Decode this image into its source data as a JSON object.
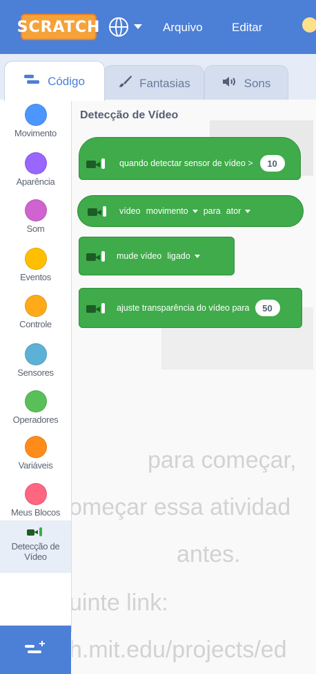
{
  "menubar": {
    "logo": "SCRATCH",
    "file_label": "Arquivo",
    "edit_label": "Editar",
    "icons": [
      "globe-icon",
      "chevron-down-icon",
      "lightbulb-icon"
    ]
  },
  "tabs": [
    {
      "label": "Código",
      "icon": "code-icon",
      "active": true
    },
    {
      "label": "Fantasias",
      "icon": "brush-icon",
      "active": false
    },
    {
      "label": "Sons",
      "icon": "speaker-icon",
      "active": false
    }
  ],
  "categories": [
    {
      "label": "Movimento",
      "color": "#4c97ff"
    },
    {
      "label": "Aparência",
      "color": "#9966ff"
    },
    {
      "label": "Som",
      "color": "#cf63cf"
    },
    {
      "label": "Eventos",
      "color": "#ffbf00"
    },
    {
      "label": "Controle",
      "color": "#ffab19"
    },
    {
      "label": "Sensores",
      "color": "#5cb1d6"
    },
    {
      "label": "Operadores",
      "color": "#59c059"
    },
    {
      "label": "Variáveis",
      "color": "#ff8c1a"
    },
    {
      "label": "Meus Blocos",
      "color": "#ff6680"
    },
    {
      "label": "Detecção de Vídeo",
      "icon": "video-sensing-icon",
      "selected": true
    }
  ],
  "palette": {
    "title": "Detecção de Vídeo",
    "blocks": {
      "when_motion": {
        "text": "quando detectar sensor de vídeo >",
        "value": "10"
      },
      "video_reporter": {
        "text_video": "vídeo",
        "attribute": "movimento",
        "text_on": "para",
        "target": "ator"
      },
      "turn_video": {
        "text": "mude vídeo",
        "state": "ligado"
      },
      "set_transparency": {
        "text": "ajuste transparência do vídeo para",
        "value": "50"
      }
    }
  },
  "background_text": {
    "line1": "para começar,",
    "line2": "omeçar  essa  atividad",
    "line3": "antes.",
    "line4": "uinte link:",
    "line5": "h.mit.edu/projects/ed"
  },
  "colors": {
    "menubar": "#4c7fd6",
    "block_green": "#3fab4a"
  }
}
